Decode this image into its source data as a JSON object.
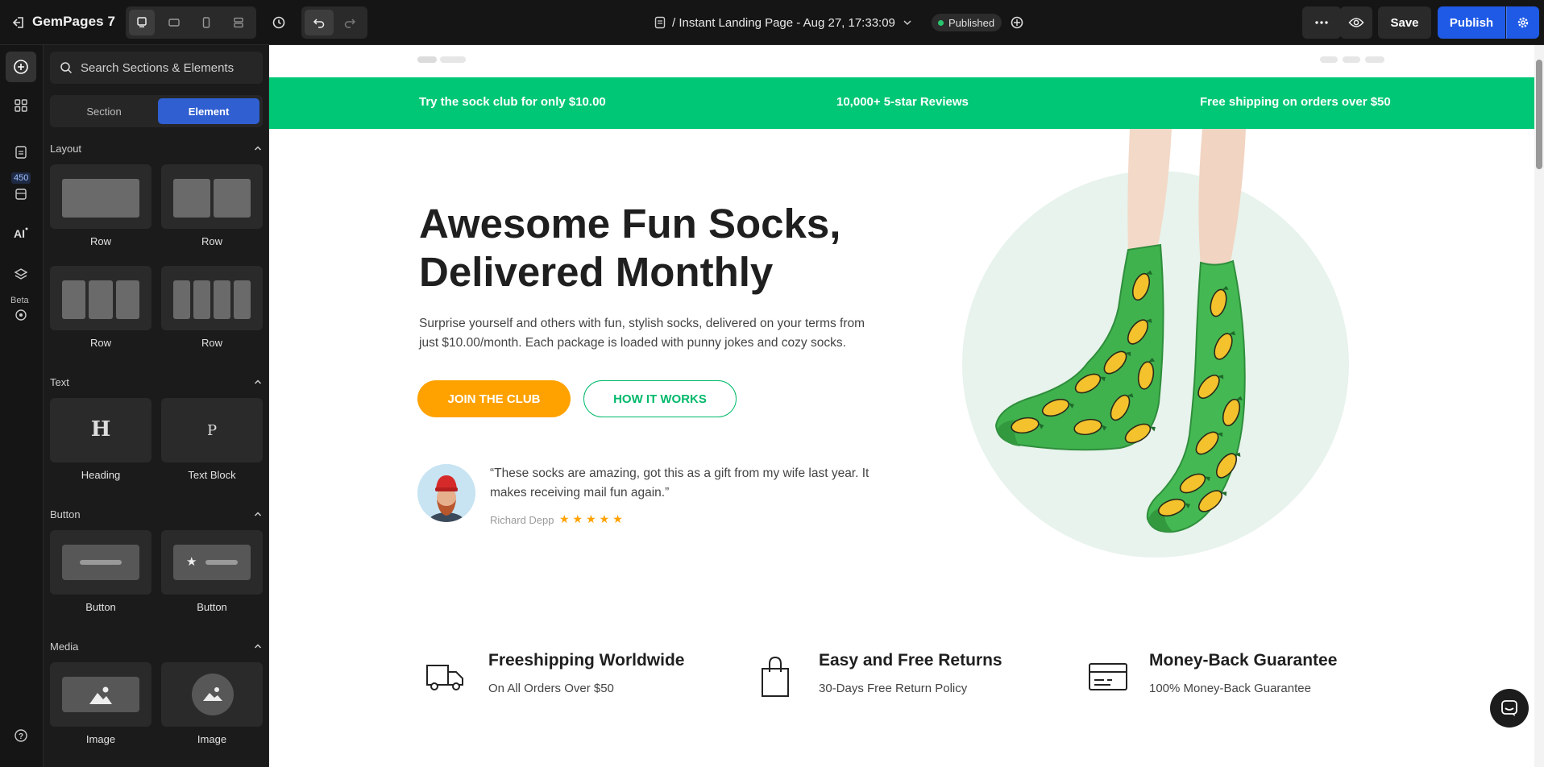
{
  "topbar": {
    "logo": "GemPages 7",
    "page_title": "/ Instant Landing Page - Aug 27, 17:33:09",
    "status": "Published",
    "save_label": "Save",
    "publish_label": "Publish"
  },
  "rail": {
    "count_badge": "450",
    "beta_label": "Beta"
  },
  "panel": {
    "search_placeholder": "Search Sections & Elements",
    "tabs": {
      "section": "Section",
      "element": "Element"
    },
    "categories": {
      "layout": "Layout",
      "text": "Text",
      "button": "Button",
      "media": "Media"
    },
    "layout_items": [
      "Row",
      "Row",
      "Row",
      "Row"
    ],
    "text_items": [
      "Heading",
      "Text Block"
    ],
    "button_items": [
      "Button",
      "Button"
    ],
    "media_items": [
      "Image",
      "Image"
    ],
    "heading_glyph": "H",
    "text_glyph": "P"
  },
  "canvas": {
    "announcement": {
      "left": "Try the sock club for only $10.00",
      "center": "10,000+ 5-star Reviews",
      "right": "Free shipping on orders over $50"
    },
    "hero": {
      "title_line1": "Awesome Fun Socks,",
      "title_line2": "Delivered Monthly",
      "description": "Surprise yourself and others with fun, stylish socks, delivered on your terms from just $10.00/month. Each package is loaded with punny jokes and cozy socks.",
      "primary_cta": "JOIN THE CLUB",
      "secondary_cta": "HOW IT WORKS",
      "testimonial": "“These socks are amazing, got this as a gift from my wife last year. It makes receiving mail fun again.”",
      "reviewer": "Richard Depp",
      "rating": 5,
      "stars": "★★★★★"
    },
    "features": [
      {
        "icon": "truck-icon",
        "title": "Freeshipping Worldwide",
        "subtitle": "On All Orders Over $50"
      },
      {
        "icon": "shopping-bag-icon",
        "title": "Easy and Free Returns",
        "subtitle": "30-Days Free Return Policy"
      },
      {
        "icon": "credit-card-icon",
        "title": "Money-Back Guarantee",
        "subtitle": "100% Money-Back Guarantee"
      }
    ]
  },
  "colors": {
    "announcement_green": "#00c775",
    "cta_orange": "#ffa200",
    "cta_outline_green": "#00b96b",
    "publish_blue": "#1f5ae6",
    "editor_dark": "#151515",
    "hero_circle": "#e7f3ec"
  }
}
